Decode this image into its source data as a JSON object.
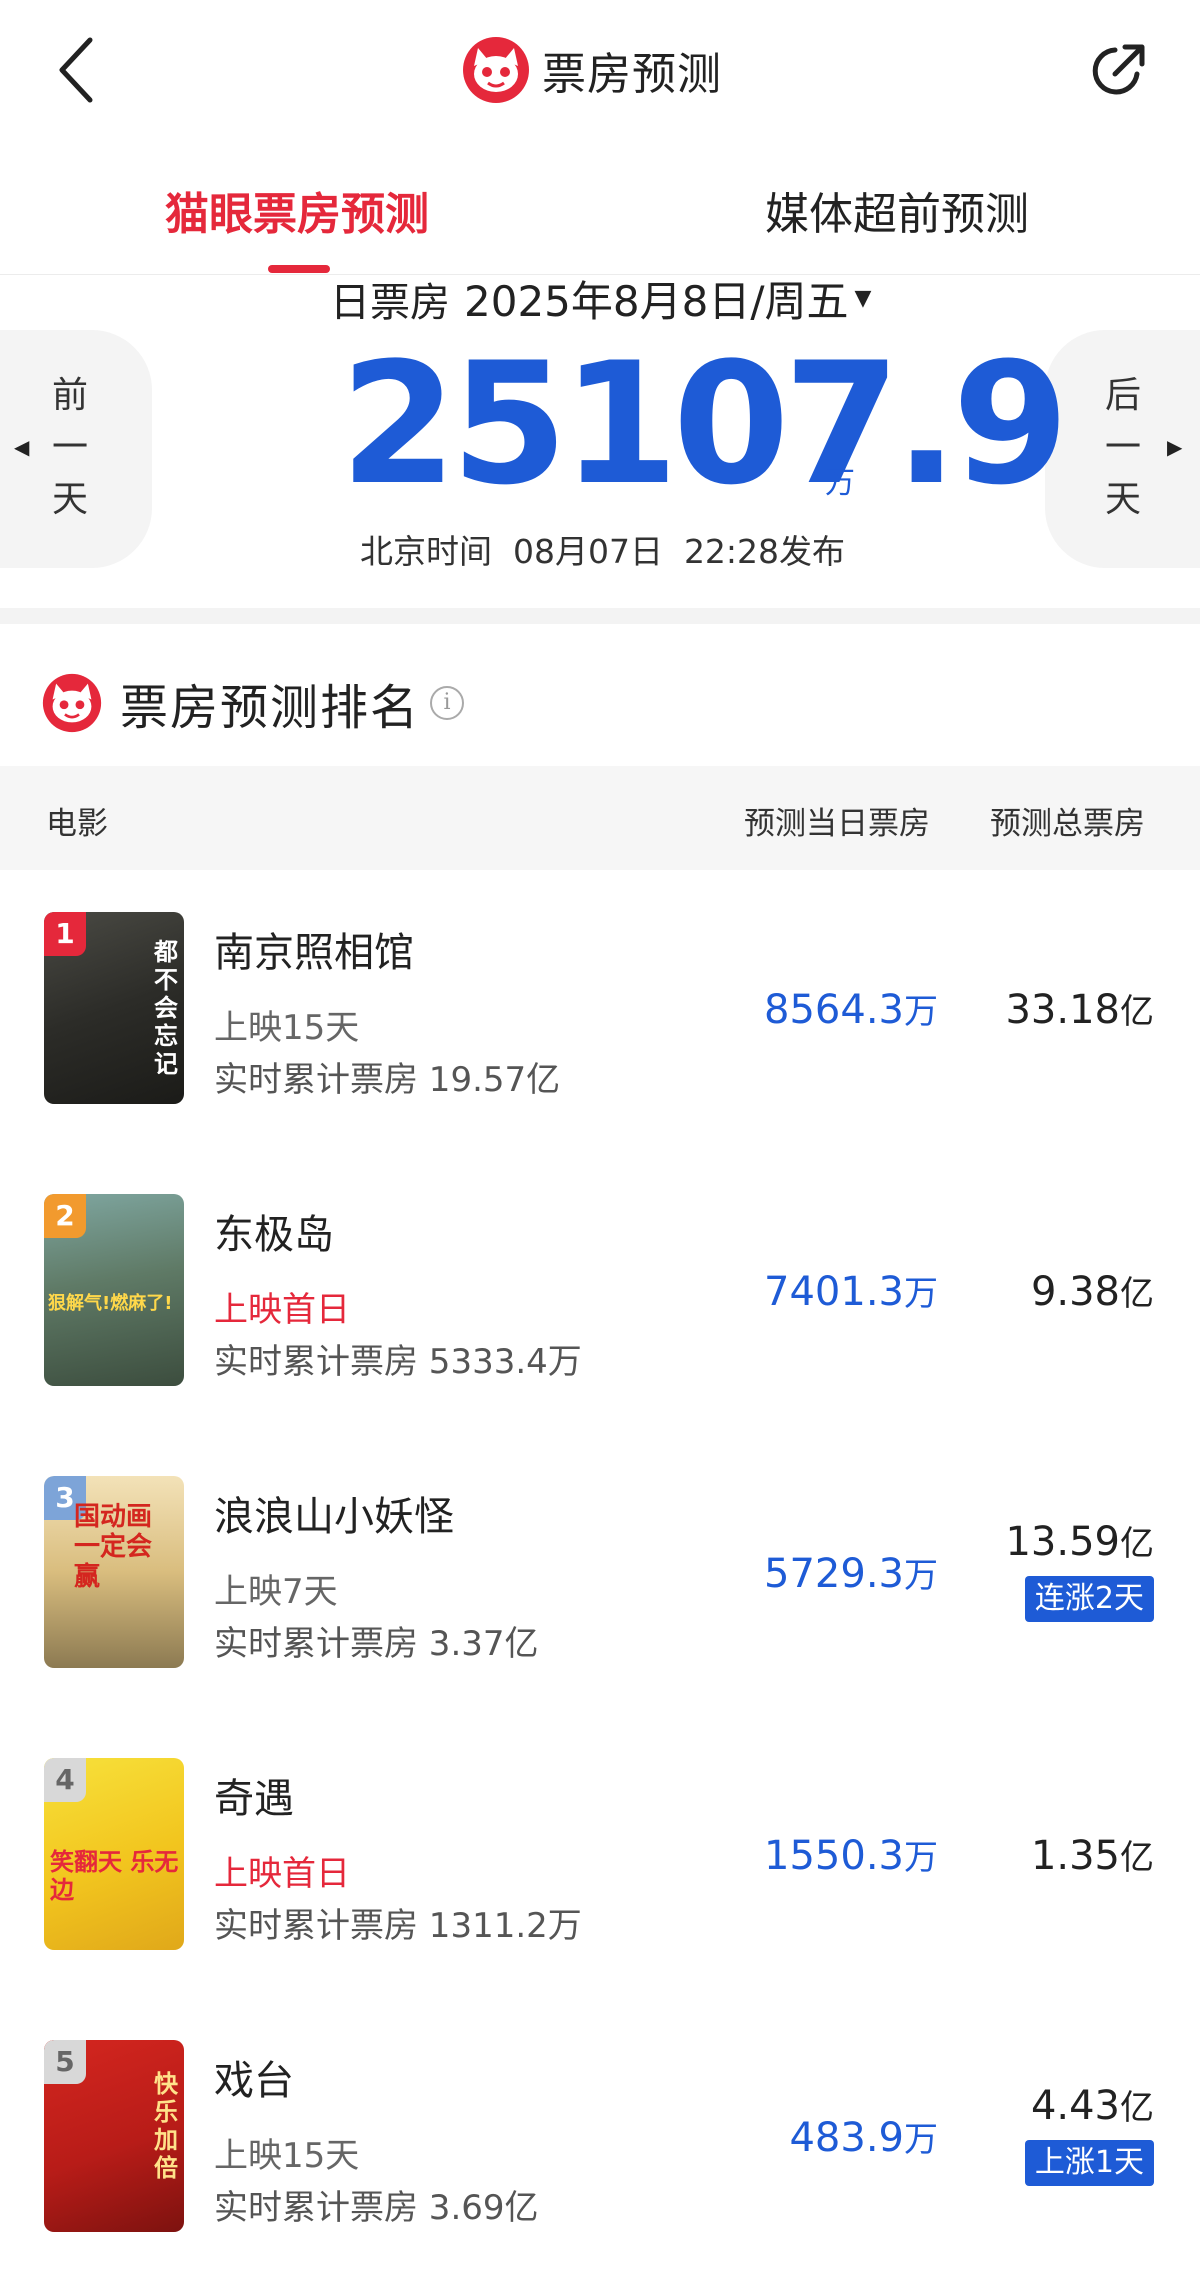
{
  "header": {
    "title": "票房预测"
  },
  "tabs": [
    {
      "label": "猫眼票房预测",
      "active": true
    },
    {
      "label": "媒体超前预测",
      "active": false
    }
  ],
  "date": {
    "label": "日票房",
    "value": "2025年8月8日/周五"
  },
  "nav": {
    "prev": "前一天",
    "next": "后一天"
  },
  "forecast": {
    "value": "25107.9",
    "unit": "万",
    "published": "北京时间  08月07日  22:28发布"
  },
  "ranking": {
    "title": "票房预测排名",
    "columns": {
      "movie": "电影",
      "day_box": "预测当日票房",
      "total_box": "预测总票房"
    },
    "rows": [
      {
        "rank": "1",
        "name": "南京照相馆",
        "days": "上映15天",
        "first_day": false,
        "cumulative": "实时累计票房 19.57亿",
        "day_value": "8564.3",
        "day_unit": "万",
        "total_value": "33.18",
        "total_unit": "亿",
        "badge": "",
        "poster_text": "都不会忘记"
      },
      {
        "rank": "2",
        "name": "东极岛",
        "days": "上映首日",
        "first_day": true,
        "cumulative": "实时累计票房 5333.4万",
        "day_value": "7401.3",
        "day_unit": "万",
        "total_value": "9.38",
        "total_unit": "亿",
        "badge": "",
        "poster_text": "狠解气!燃麻了!"
      },
      {
        "rank": "3",
        "name": "浪浪山小妖怪",
        "days": "上映7天",
        "first_day": false,
        "cumulative": "实时累计票房 3.37亿",
        "day_value": "5729.3",
        "day_unit": "万",
        "total_value": "13.59",
        "total_unit": "亿",
        "badge": "连涨2天",
        "poster_text": "国动画一定会赢"
      },
      {
        "rank": "4",
        "name": "奇遇",
        "days": "上映首日",
        "first_day": true,
        "cumulative": "实时累计票房 1311.2万",
        "day_value": "1550.3",
        "day_unit": "万",
        "total_value": "1.35",
        "total_unit": "亿",
        "badge": "",
        "poster_text": "笑翻天 乐无边"
      },
      {
        "rank": "5",
        "name": "戏台",
        "days": "上映15天",
        "first_day": false,
        "cumulative": "实时累计票房 3.69亿",
        "day_value": "483.9",
        "day_unit": "万",
        "total_value": "4.43",
        "total_unit": "亿",
        "badge": "上涨1天",
        "poster_text": "快乐加倍"
      }
    ]
  },
  "colors": {
    "accent_red": "#e5283b",
    "value_blue": "#1e5bd6"
  }
}
